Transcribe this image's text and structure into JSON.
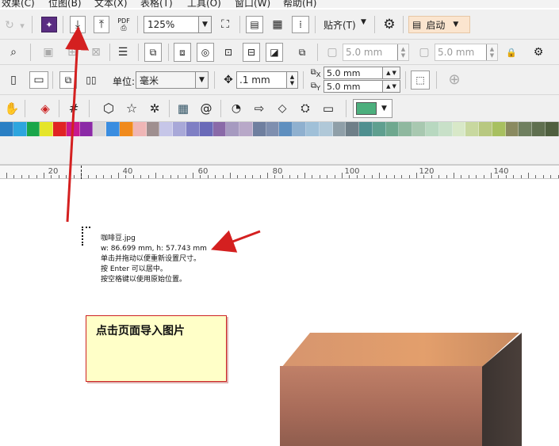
{
  "menubar": {
    "items": [
      "效果(C)",
      "位图(B)",
      "文本(X)",
      "表格(T)",
      "工具(O)",
      "窗口(W)",
      "帮助(H)"
    ]
  },
  "toolbar1": {
    "pdf_label": "PDF",
    "zoom_value": "125%",
    "snap_label": "贴齐(T)",
    "launch_label": "启动"
  },
  "toolbar2": {
    "outline_width_1": "5.0 mm",
    "outline_width_2": "5.0 mm"
  },
  "toolbar3": {
    "units_label": "单位:",
    "units_value": "毫米",
    "nudge_value": ".1 mm",
    "dup_x": "5.0 mm",
    "dup_y": "5.0 mm",
    "x_sub": "X",
    "y_sub": "Y"
  },
  "palette": {
    "colors": [
      "#2a7fc4",
      "#2da5de",
      "#1aa64a",
      "#e5e52a",
      "#e02424",
      "#c8198f",
      "#8b2aa6",
      "#d8d8d8",
      "#3a8de0",
      "#f08a1c",
      "#efb6b6",
      "#9f8f8f",
      "#c6c6e8",
      "#a8a8d8",
      "#7f7fc4",
      "#6a6ab8",
      "#8a6aa8",
      "#a69ac0",
      "#b8a8c8",
      "#6f7f9f",
      "#7f8faf",
      "#5f8fbf",
      "#8fb0cf",
      "#a0c0d8",
      "#b0c8d8",
      "#8f9fa8",
      "#6f7f88",
      "#4f8f8f",
      "#5f9f8f",
      "#6fa88f",
      "#8fb89f",
      "#a8c8b0",
      "#b8d8c0",
      "#c8e0c8",
      "#d8e8c8",
      "#c8d89f",
      "#b8c880",
      "#a8c060",
      "#8a8a60",
      "#6f7f5f",
      "#5f6f4f",
      "#4f5f3f"
    ]
  },
  "ruler": {
    "labels": [
      "20",
      "40",
      "60",
      "80",
      "100",
      "120",
      "140"
    ]
  },
  "cursor_info": {
    "filename": "咖啡豆.jpg",
    "dimensions": "w: 86.699 mm, h: 57.743 mm",
    "hint1": "单击并拖动以便重新设置尺寸。",
    "hint2": "按 Enter 可以居中。",
    "hint3": "按空格键以使用原始位置。"
  },
  "note": {
    "text": "点击页面导入图片"
  },
  "colors": {
    "arrow_red": "#d42020",
    "fill_swatch": "#4caf7d",
    "accent": "#c22"
  }
}
